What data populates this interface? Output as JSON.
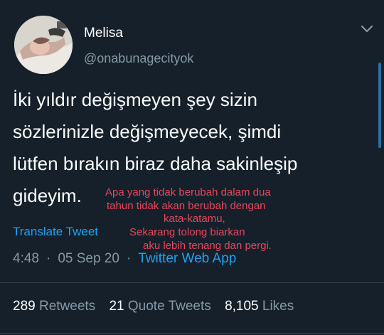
{
  "author": {
    "display_name": "Melisa",
    "handle": "@onabunagecityok"
  },
  "tweet": {
    "lines": [
      "İki yıldır değişmeyen şey sizin",
      "sözlerinizle değişmeyecek, şimdi",
      "lütfen bırakın biraz daha sakinleşip",
      "gideyim."
    ]
  },
  "translation_overlay": {
    "line1": "Apa yang tidak berubah dalam dua",
    "line2": "tahun tidak akan berubah dengan",
    "line3": "kata-katamu,",
    "line4": "Sekarang tolong biarkan",
    "line5": "aku lebih tenang dan pergi."
  },
  "translate_link": "Translate Tweet",
  "meta": {
    "time": "4:48",
    "date": "05 Sep 20",
    "separator": "·",
    "source": "Twitter Web App"
  },
  "stats": {
    "retweets_count": "289",
    "retweets_label": "Retweets",
    "quotes_count": "21",
    "quotes_label": "Quote Tweets",
    "likes_count": "8,105",
    "likes_label": "Likes"
  },
  "icons": {
    "menu": "chevron-down-icon"
  },
  "colors": {
    "background": "#15202b",
    "accent": "#1da1f2",
    "secondary_text": "#8899a6",
    "overlay_text": "#e8465b"
  }
}
